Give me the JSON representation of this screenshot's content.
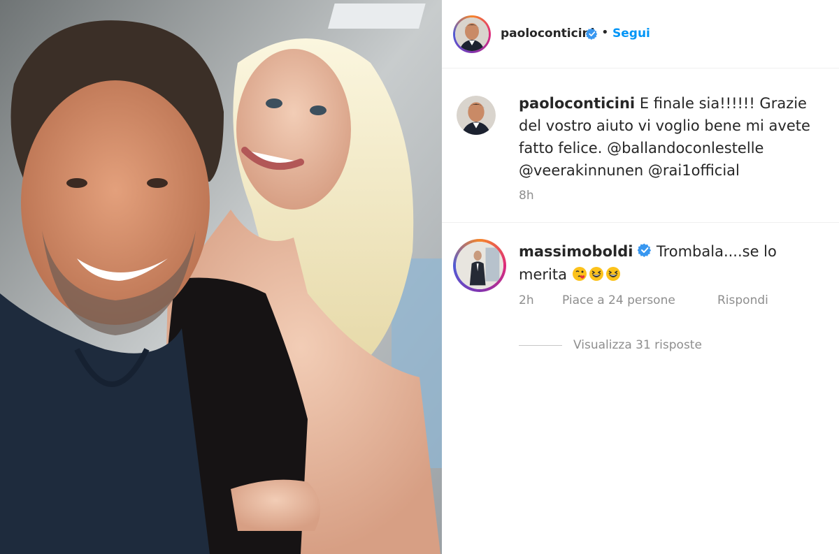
{
  "post": {
    "author": "paoloconticini",
    "follow_label": "Segui",
    "separator": "•"
  },
  "caption": {
    "username": "paoloconticini",
    "text": "E finale sia!!!!!! Grazie del vostro aiuto vi voglio bene mi avete fatto felice.",
    "mentions": [
      "@ballandoconlestelle",
      "@veerakinnunen",
      "@rai1official"
    ],
    "time": "8h"
  },
  "comment": {
    "username": "massimoboldi",
    "text": "Trombala....se lo merita",
    "time": "2h",
    "likes": "Piace a 24 persone",
    "reply_label": "Rispondi",
    "emojis": [
      "face-blowing-kiss-icon",
      "grinning-squinting-face-icon",
      "grinning-squinting-face-icon"
    ]
  },
  "view_replies": "Visualizza 31 risposte",
  "colors": {
    "verified": "#3897f0",
    "follow": "#0095f6",
    "muted": "#8e8e8e",
    "text": "#262626"
  }
}
